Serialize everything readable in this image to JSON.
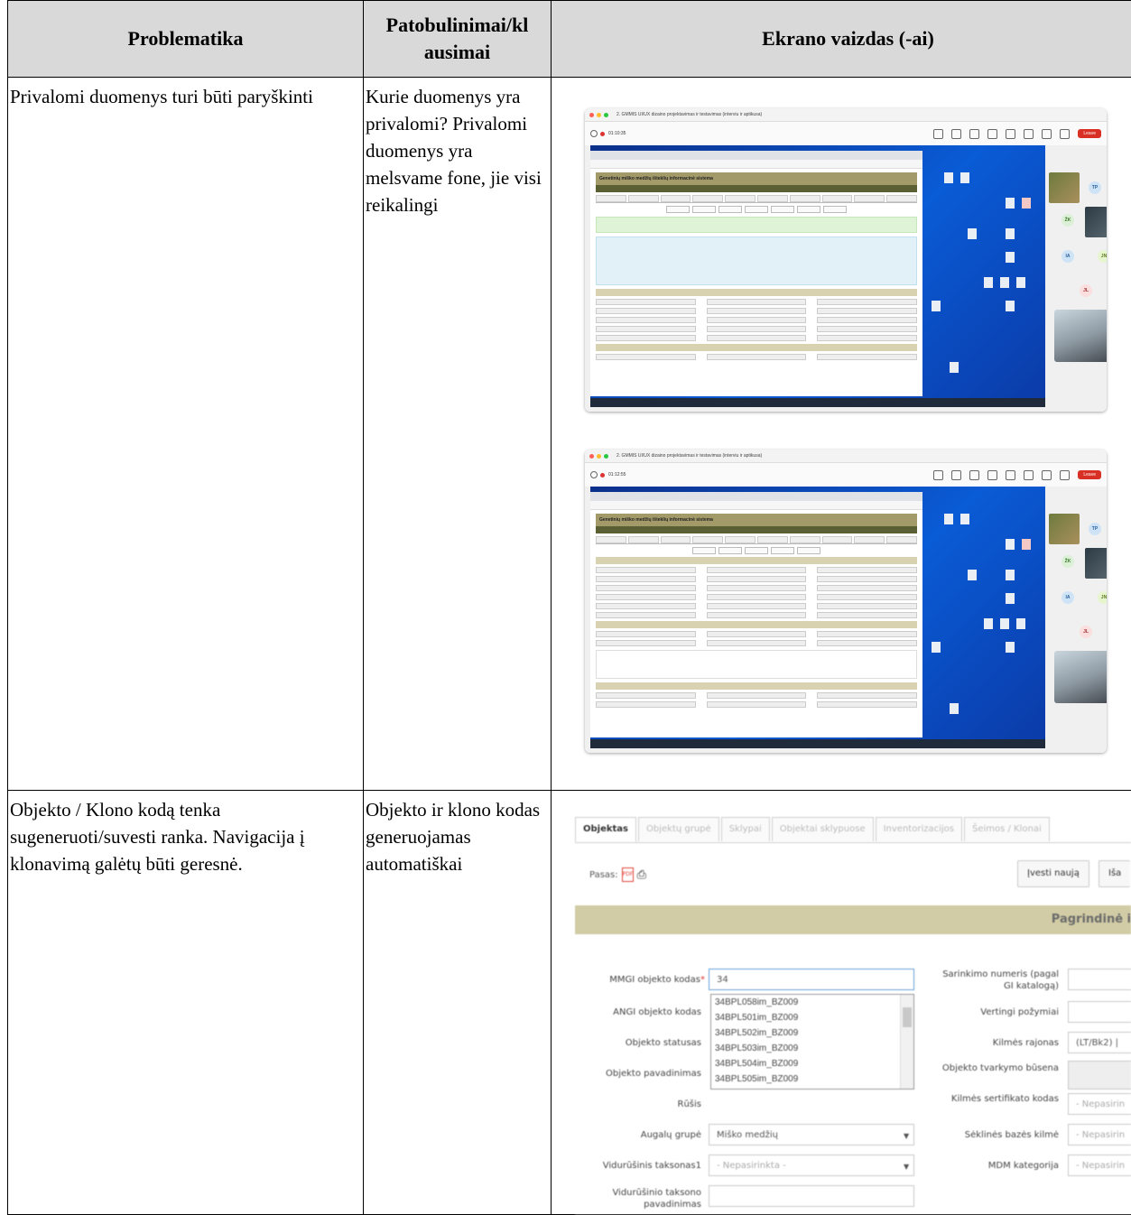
{
  "table": {
    "headers": [
      "Problematika",
      "Patobulinimai/kl\nausimai",
      "Ekrano vaizdas (-ai)"
    ],
    "rows": [
      {
        "problem": "Privalomi duomenys turi būti paryškinti",
        "improvement": "Kurie duomenys yra privalomi? Privalomi duomenys yra melsvame fone, jie visi reikalingi"
      },
      {
        "problem": "Objekto / Klono kodą tenka sugeneruoti/suvesti ranka. Navigacija į klonavimą galėtų būti geresnė.",
        "improvement": "Objekto ir klono kodas generuojamas automatiškai"
      }
    ]
  },
  "meeting": {
    "title": "2. GMMIS UI/UX dizaino projektavimas ir testavimas (interviu ir aptikusa)",
    "time_1": "01:10:35",
    "time_2": "01:12:55",
    "leave_label": "Leave",
    "tool_labels": [
      "Chat",
      "People",
      "Raise",
      "React",
      "View",
      "More",
      "Camera",
      "Mic",
      "Share"
    ],
    "app_title": "Genetinių miško medžių išteklių informacinė sistema",
    "participants": [
      "TP",
      "ŽK",
      "IA",
      "JN",
      "JL"
    ]
  },
  "form_crop": {
    "tabs": [
      "Objektas",
      "Objektų grupė",
      "Sklypai",
      "Objektai sklypuose",
      "Inventorizacijos",
      "Šeimos / Klonai"
    ],
    "pasas_label": "Pasas:",
    "btn_new": "Įvesti naują",
    "btn_cut": "Iša",
    "section_title": "Pagrindinė i",
    "fields_left": [
      {
        "label": "MMGI objekto kodas",
        "value": "34"
      },
      {
        "label": "ANGI objekto kodas",
        "value": ""
      },
      {
        "label": "Objekto statusas",
        "value": ""
      },
      {
        "label": "Objekto pavadinimas",
        "value": ""
      },
      {
        "label": "Rūšis",
        "value": ""
      },
      {
        "label": "Augalų grupė",
        "value": "Miško medžių"
      },
      {
        "label": "Vidurūšinis taksonas1",
        "value": "- Nepasirinkta -"
      },
      {
        "label": "Vidurūšinio taksono pavadinimas",
        "value": ""
      }
    ],
    "fields_right": [
      {
        "label": "Sarinkimo numeris (pagal GI katalogą)",
        "value": ""
      },
      {
        "label": "Vertingi požymiai",
        "value": ""
      },
      {
        "label": "Kilmės rajonas",
        "value": "(LT/Bk2) |"
      },
      {
        "label": "Objekto tvarkymo būsena",
        "value": ""
      },
      {
        "label": "Kilmės sertifikato kodas",
        "value": "- Nepasirin"
      },
      {
        "label": "Sėklinės bazės kilmė",
        "value": "- Nepasirin"
      },
      {
        "label": "MDM kategorija",
        "value": "- Nepasirin"
      }
    ],
    "dropdown": [
      "34BPL058im_BZ009",
      "34BPL501im_BZ009",
      "34BPL502im_BZ009",
      "34BPL503im_BZ009",
      "34BPL504im_BZ009",
      "34BPL505im_BZ009"
    ]
  }
}
